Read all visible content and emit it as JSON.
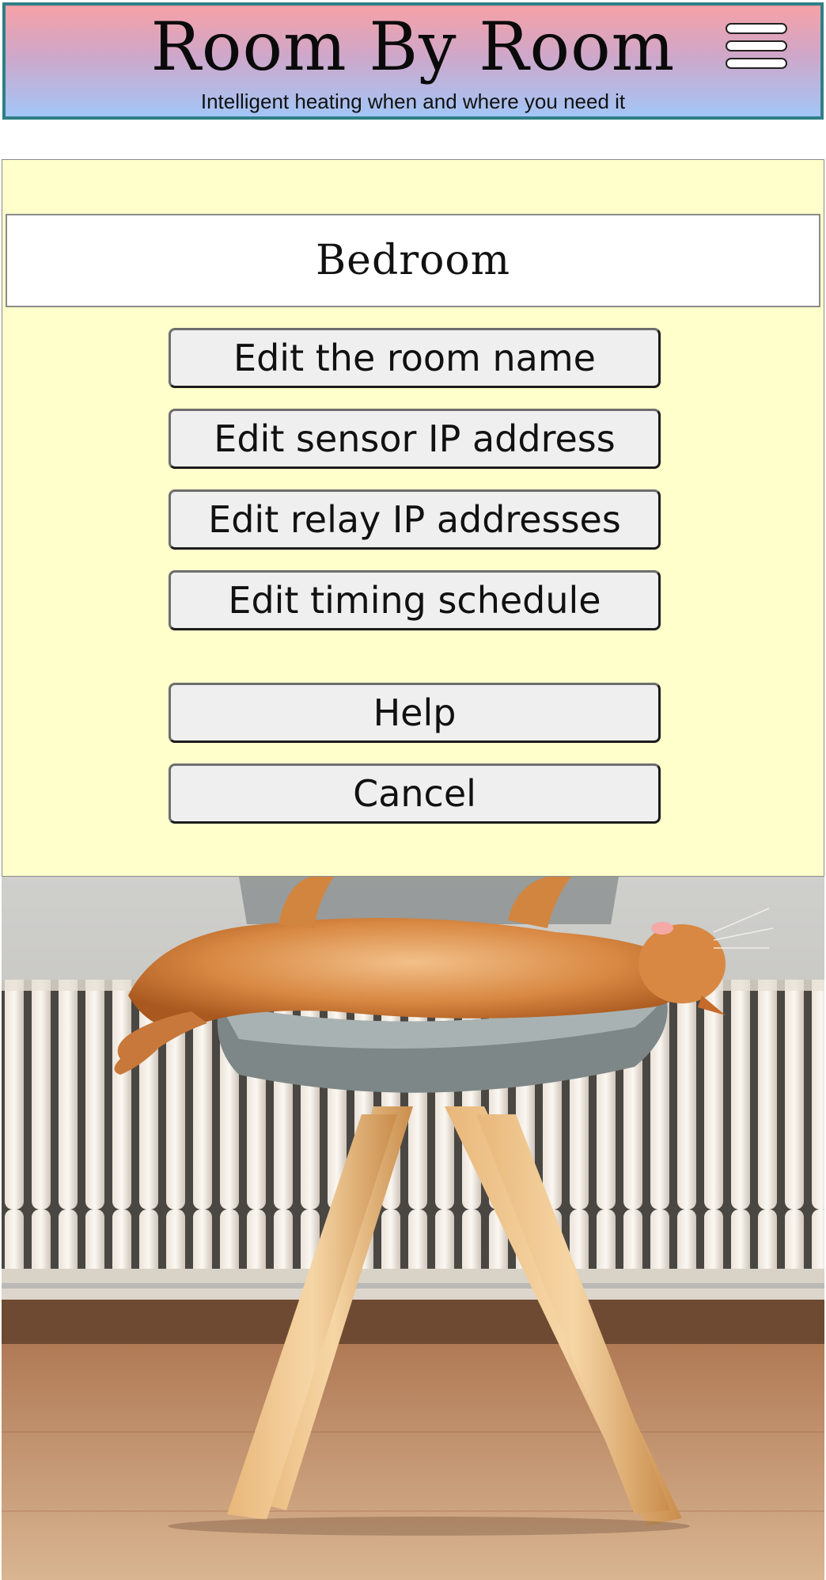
{
  "header": {
    "title": "Room By Room",
    "subtitle": "Intelligent heating when and where you need it",
    "menu_icon": "hamburger-menu-icon"
  },
  "room": {
    "name": "Bedroom"
  },
  "actions": {
    "edit_name": "Edit the room name",
    "edit_sensor_ip": "Edit sensor IP address",
    "edit_relay_ips": "Edit relay IP addresses",
    "edit_schedule": "Edit timing schedule",
    "help": "Help",
    "cancel": "Cancel"
  },
  "colors": {
    "header_top": "#f7a1a6",
    "header_bottom": "#a3c6f7",
    "header_border": "#2f7f86",
    "panel_background": "#ffffcc",
    "button_background": "#efefef"
  },
  "photo": {
    "subject": "cat-on-chair-by-radiator"
  }
}
